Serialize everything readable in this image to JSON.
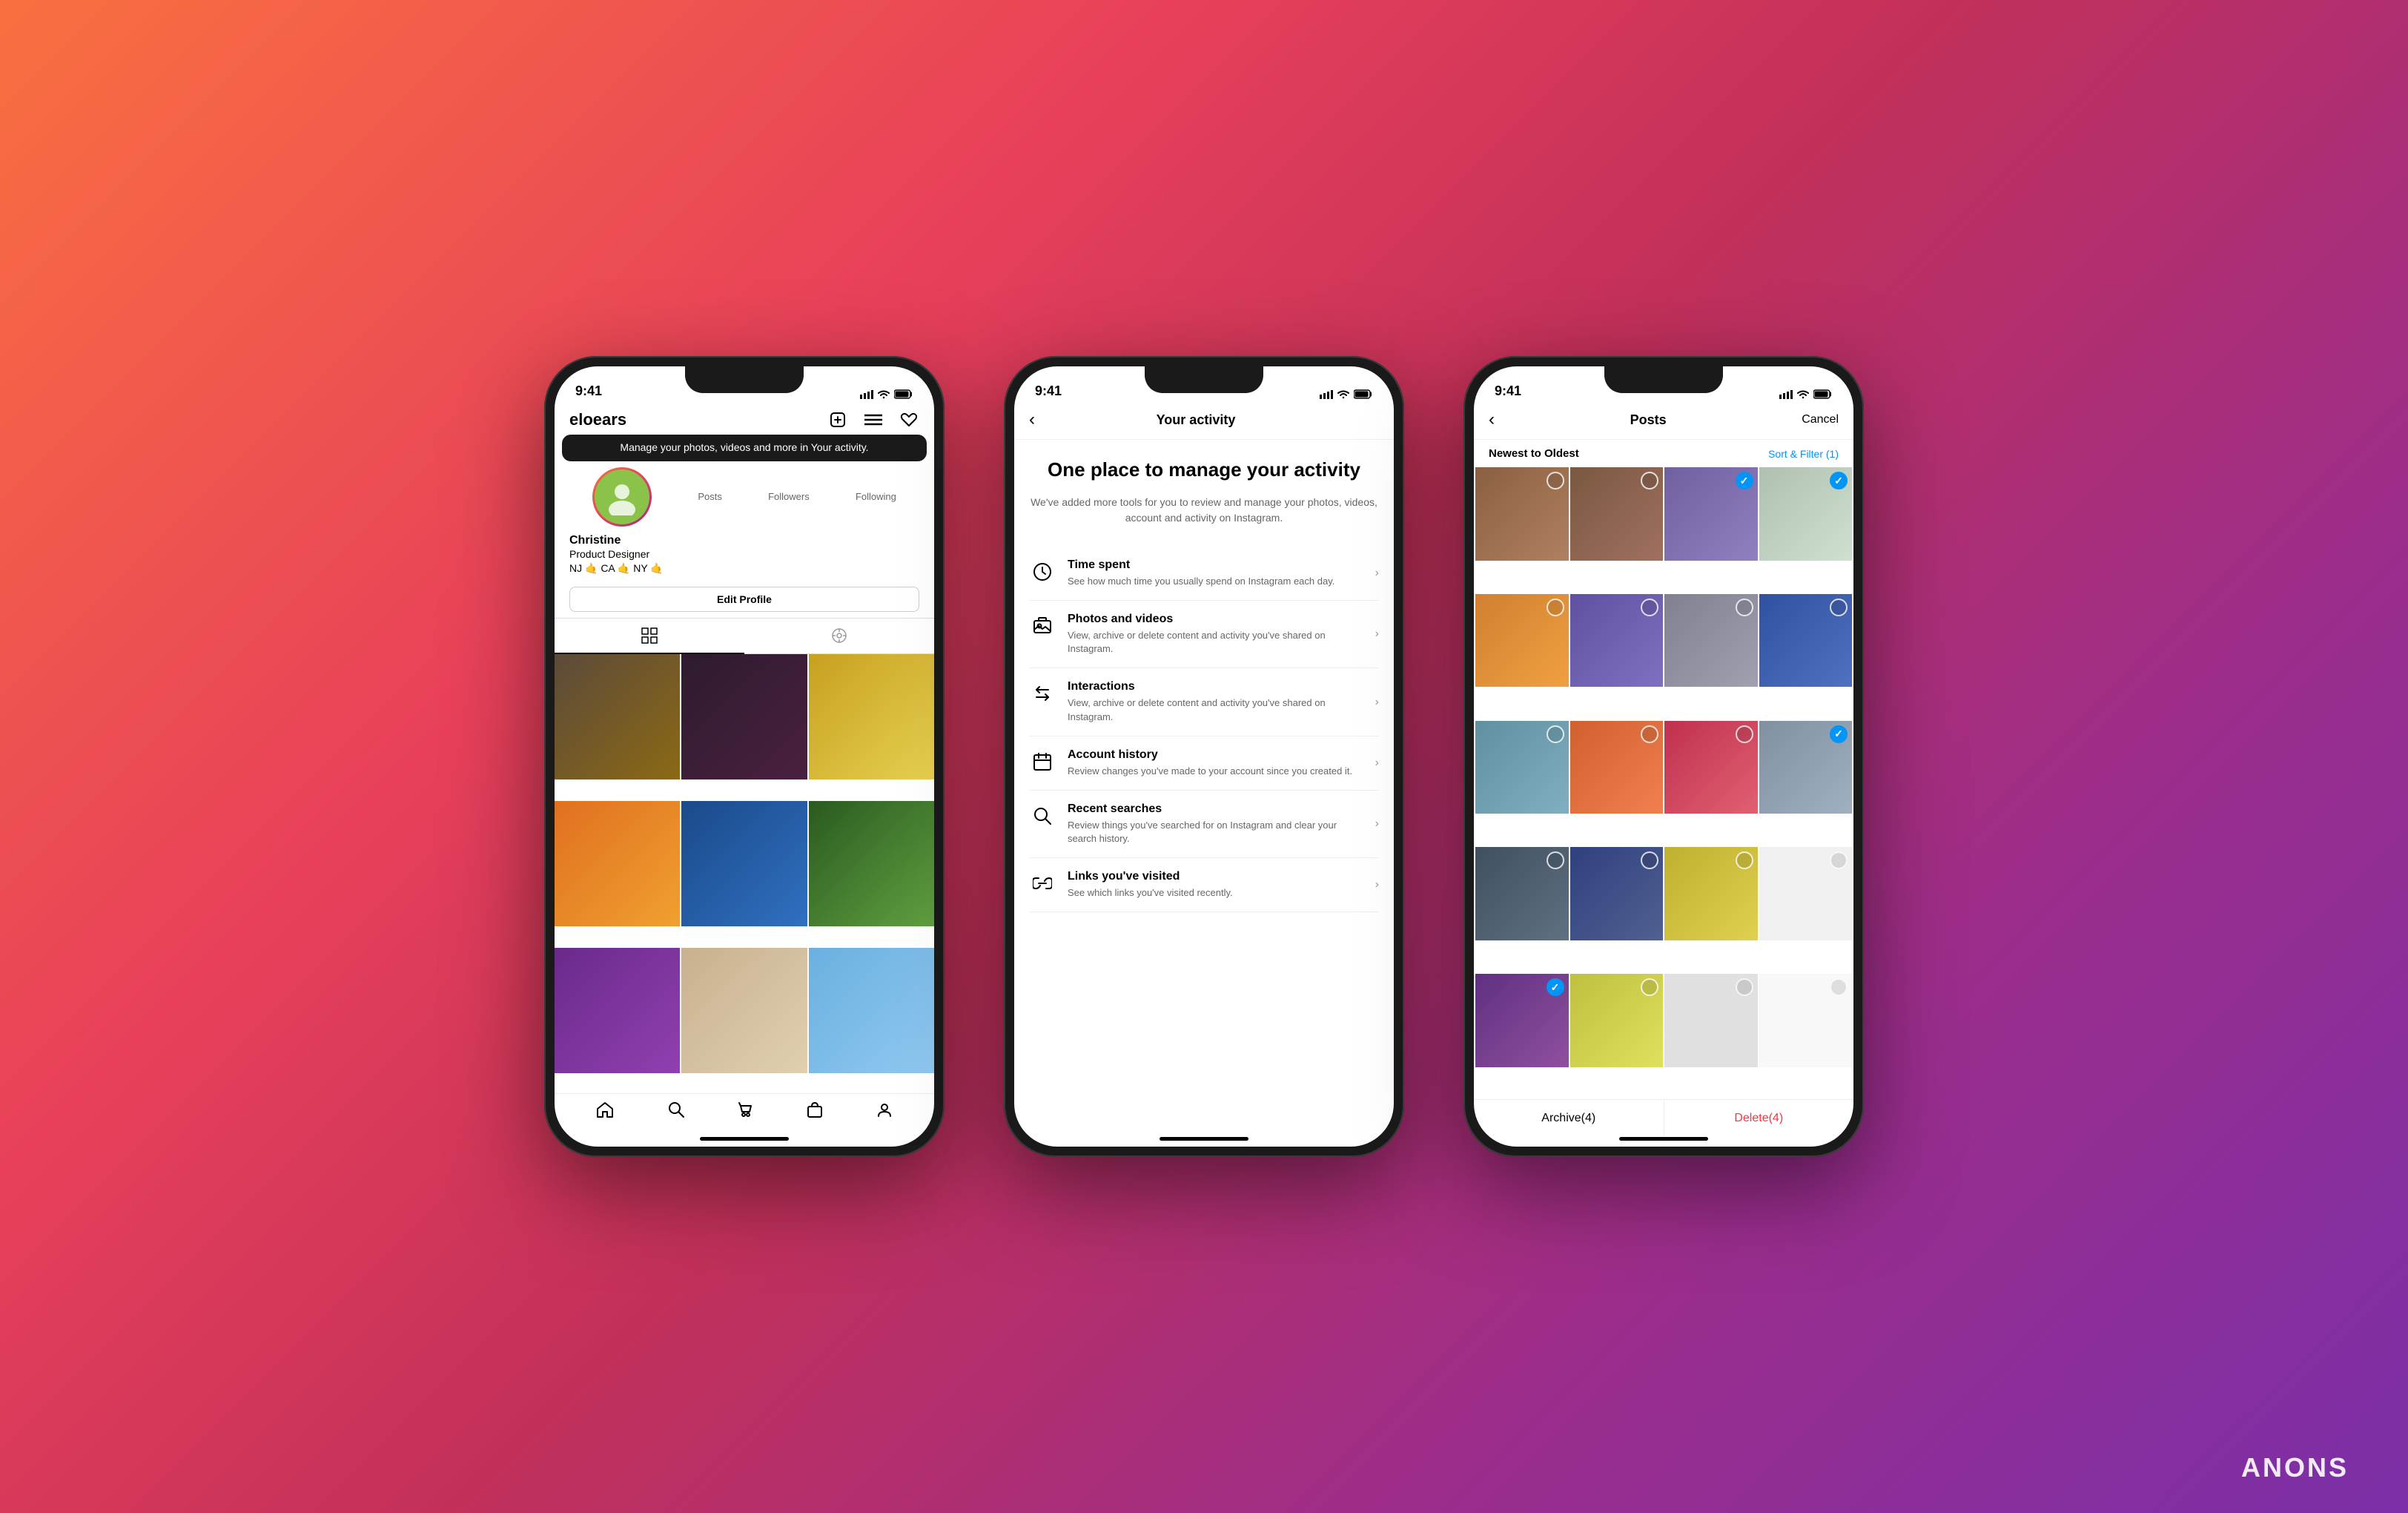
{
  "background": "gradient",
  "phones": {
    "phone1": {
      "statusBar": {
        "time": "9:41"
      },
      "header": {
        "username": "eloears",
        "icons": [
          "+",
          "≡",
          "♡"
        ]
      },
      "tooltip": "Manage your photos, videos and more in Your activity.",
      "profile": {
        "avatar": "👤",
        "stats": [
          {
            "label": "Posts",
            "value": ""
          },
          {
            "label": "Followers",
            "value": ""
          },
          {
            "label": "Following",
            "value": ""
          }
        ],
        "name": "Christine",
        "bio": "Product Designer",
        "location": "NJ 🤙 CA 🤙 NY 🤙"
      },
      "editProfileBtn": "Edit Profile",
      "photos": [
        {
          "color": "brown"
        },
        {
          "color": "dark"
        },
        {
          "color": "yellow"
        },
        {
          "color": "orange"
        },
        {
          "color": "blue"
        },
        {
          "color": "green"
        },
        {
          "color": "purple"
        },
        {
          "color": "beige"
        },
        {
          "color": "sky"
        }
      ],
      "bottomNav": [
        "🏠",
        "🔍",
        "📦",
        "🛍️",
        "👤"
      ]
    },
    "phone2": {
      "statusBar": {
        "time": "9:41"
      },
      "header": {
        "backArrow": "‹",
        "title": "Your activity"
      },
      "heroTitle": "One place to manage your activity",
      "heroDesc": "We've added more tools for you to review and manage your photos, videos, account and activity on Instagram.",
      "menuItems": [
        {
          "icon": "⏱",
          "title": "Time spent",
          "desc": "See how much time you usually spend on Instagram each day."
        },
        {
          "icon": "🖼",
          "title": "Photos and videos",
          "desc": "View, archive or delete content and activity you've shared on Instagram."
        },
        {
          "icon": "↔",
          "title": "Interactions",
          "desc": "View, archive or delete content and activity you've shared on Instagram."
        },
        {
          "icon": "📅",
          "title": "Account history",
          "desc": "Review changes you've made to your account since you created it."
        },
        {
          "icon": "🔍",
          "title": "Recent searches",
          "desc": "Review things you've searched for on Instagram and clear your search history."
        },
        {
          "icon": "🔗",
          "title": "Links you've visited",
          "desc": "See which links you've visited recently."
        }
      ]
    },
    "phone3": {
      "statusBar": {
        "time": "9:41"
      },
      "header": {
        "backArrow": "‹",
        "title": "Posts",
        "cancelLabel": "Cancel"
      },
      "filterRow": {
        "sortLabel": "Newest to Oldest",
        "filterLabel": "Sort & Filter (1)"
      },
      "photos": [
        {
          "color": "#a0785a",
          "selected": false
        },
        {
          "color": "#8a6a50",
          "selected": false
        },
        {
          "color": "#9070a0",
          "selected": true
        },
        {
          "color": "#c0d0c0",
          "selected": true
        },
        {
          "color": "#d08030",
          "selected": false
        },
        {
          "color": "#7060a0",
          "selected": false
        },
        {
          "color": "#8a8090",
          "selected": false
        },
        {
          "color": "#4060a0",
          "selected": false
        },
        {
          "color": "#7090a0",
          "selected": false
        },
        {
          "color": "#e08040",
          "selected": false
        },
        {
          "color": "#c04060",
          "selected": false
        },
        {
          "color": "#90a0b0",
          "selected": false
        },
        {
          "color": "#506070",
          "selected": false
        },
        {
          "color": "#405080",
          "selected": false
        },
        {
          "color": "#c0b040",
          "selected": true
        },
        {
          "color": "#a0a0a0",
          "selected": false
        },
        {
          "color": "#704080",
          "selected": true
        },
        {
          "color": "#d0c060",
          "selected": false
        },
        {
          "color": "#c0c0c0",
          "selected": false
        },
        {
          "color": "#ffffff",
          "selected": false
        }
      ],
      "bottomActions": {
        "archiveLabel": "Archive(4)",
        "deleteLabel": "Delete(4)"
      }
    }
  },
  "watermark": "ANONS"
}
